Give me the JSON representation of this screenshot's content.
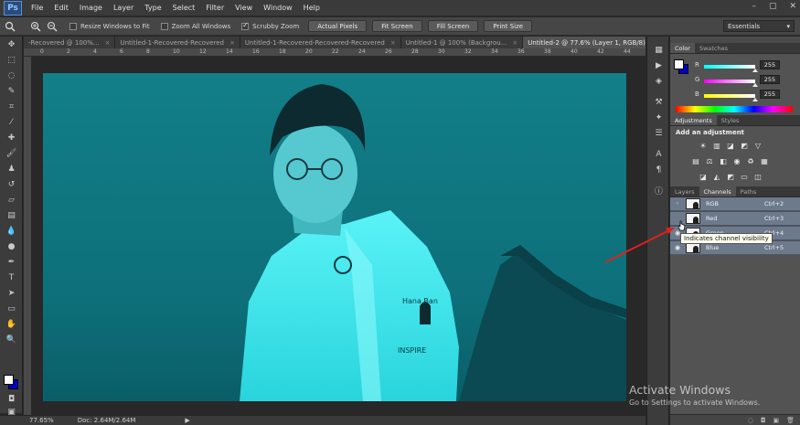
{
  "app": {
    "logo": "Ps",
    "menus": [
      "File",
      "Edit",
      "Image",
      "Layer",
      "Type",
      "Select",
      "Filter",
      "View",
      "Window",
      "Help"
    ],
    "window_controls": [
      "–",
      "▢",
      "✕"
    ]
  },
  "options_bar": {
    "resize_windows_label": "Resize Windows to Fit",
    "resize_windows_checked": false,
    "zoom_all_label": "Zoom All Windows",
    "zoom_all_checked": false,
    "scrubby_zoom_label": "Scrubby Zoom",
    "scrubby_zoom_checked": true,
    "actual_pixels_label": "Actual Pixels",
    "fit_screen_label": "Fit Screen",
    "fill_screen_label": "Fill Screen",
    "print_size_label": "Print Size",
    "workspace": "Essentials"
  },
  "document_tabs": [
    {
      "label": "-Recovered @ 100%...",
      "active": false
    },
    {
      "label": "Untitled-1-Recovered-Recovered",
      "active": false
    },
    {
      "label": "Untitled-1-Recovered-Recovered-Recovered",
      "active": false
    },
    {
      "label": "Untitled-1 @ 100% (Backgrou...",
      "active": false
    },
    {
      "label": "Untitled-2 @ 77.6% (Layer 1, RGB/8) *",
      "active": true
    }
  ],
  "ruler_numbers": [
    "0",
    "2",
    "4",
    "6",
    "8",
    "10",
    "12",
    "14",
    "16",
    "18",
    "20",
    "22",
    "24",
    "26",
    "28",
    "30",
    "32",
    "34",
    "36",
    "38",
    "40",
    "42",
    "44"
  ],
  "status_bar": {
    "zoom": "77.65%",
    "doc_info": "Doc: 2.64M/2.64M"
  },
  "color_panel": {
    "tabs": [
      "Color",
      "Swatches"
    ],
    "sliders": [
      {
        "label": "R",
        "value": "255",
        "gradient": "#00ffff,#ffffff"
      },
      {
        "label": "G",
        "value": "255",
        "gradient": "#ff00ff,#ffffff"
      },
      {
        "label": "B",
        "value": "255",
        "gradient": "#ffff00,#ffffff"
      }
    ],
    "foreground": "#ffffff",
    "background": "#0000c8"
  },
  "adjustments_panel": {
    "tabs": [
      "Adjustments",
      "Styles"
    ],
    "title": "Add an adjustment"
  },
  "channels_panel": {
    "tabs": [
      "Layers",
      "Channels",
      "Paths"
    ],
    "channels": [
      {
        "name": "RGB",
        "shortcut": "Ctrl+2"
      },
      {
        "name": "Red",
        "shortcut": "Ctrl+3"
      },
      {
        "name": "Green",
        "shortcut": "Ctrl+4"
      },
      {
        "name": "Blue",
        "shortcut": "Ctrl+5"
      }
    ],
    "tooltip": "Indicates channel visibility"
  },
  "image_text": {
    "jacket_logo_text": "Hana Ban",
    "jacket_sponsor_text": "INSPIRE"
  },
  "watermark": {
    "title": "Activate Windows",
    "subtitle": "Go to Settings to activate Windows."
  },
  "colors": {
    "image_teal": "#0f8c94",
    "jacket_cyan": "#3ee6ee",
    "arrow_red": "#e0201c"
  }
}
